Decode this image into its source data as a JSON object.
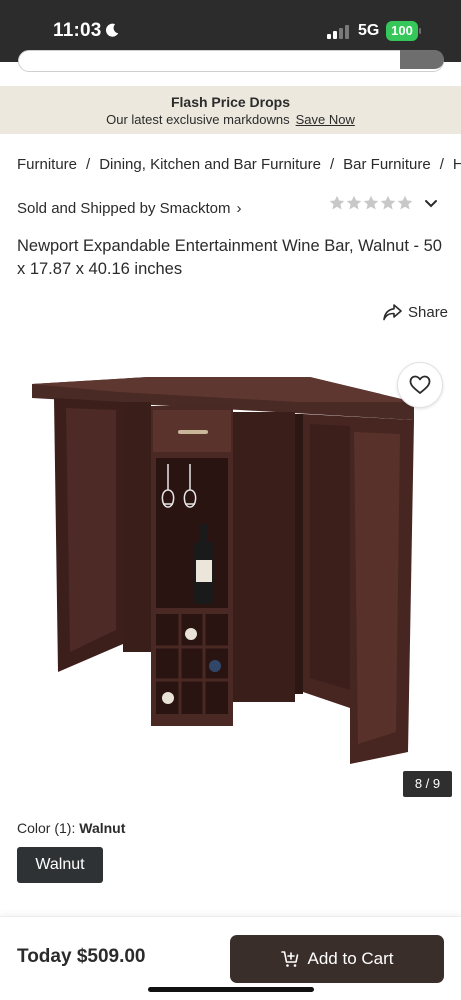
{
  "status_bar": {
    "time": "11:03",
    "network": "5G",
    "battery": "100",
    "icons": [
      "moon-icon",
      "signal-icon",
      "battery-icon"
    ]
  },
  "promo": {
    "title": "Flash Price Drops",
    "subtitle": "Our latest exclusive markdowns",
    "link": "Save Now"
  },
  "breadcrumb": [
    "Furniture",
    "Dining, Kitchen and Bar Furniture",
    "Bar Furniture",
    "H"
  ],
  "breadcrumb_separator": "/",
  "seller": {
    "text": "Sold and Shipped by Smacktom",
    "chevron": "›"
  },
  "rating": {
    "stars_filled": 0,
    "stars_total": 5,
    "star_color": "#c8c8c8"
  },
  "product": {
    "title": "Newport Expandable Entertainment Wine Bar, Walnut - 50 x 17.87 x 40.16 inches"
  },
  "share": {
    "label": "Share"
  },
  "gallery": {
    "counter": "8 / 9"
  },
  "color": {
    "label": "Color (1):",
    "selected": "Walnut",
    "options": [
      "Walnut"
    ]
  },
  "purchase": {
    "price": "Today $509.00",
    "cart_label": "Add to Cart",
    "button_color": "#3a2e2b"
  },
  "colors": {
    "status_bar_bg": "#2c2c2c",
    "promo_bg": "#ece8de",
    "battery": "#35c759"
  }
}
